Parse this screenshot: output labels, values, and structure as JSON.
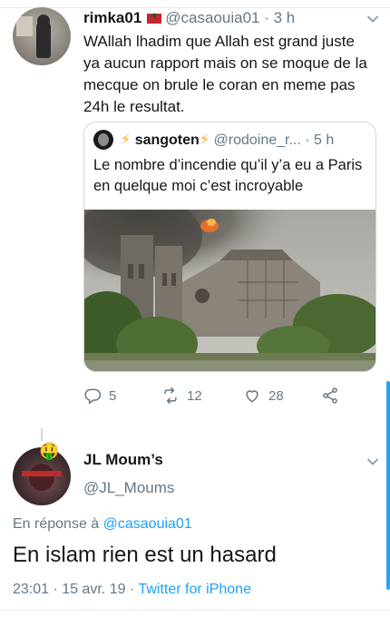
{
  "tweet": {
    "name": "rimka01",
    "handle": "@casaouia01",
    "time": "· 3 h",
    "text": "WAllah lhadim que Allah est grand juste ya aucun rapport mais on se moque de la mecque on brule le coran en meme pas 24h le resultat."
  },
  "quote": {
    "bolt": "⚡",
    "name": "sangoten",
    "handle": "@rodoine_r...",
    "time": "· 5 h",
    "text": "Le nombre d’incendie qu’il y’a eu a Paris en quelque moi c’est incroyable"
  },
  "actions": {
    "replies": "5",
    "retweets": "12",
    "likes": "28"
  },
  "reply_tweet": {
    "avatar_emoji": "🤑",
    "name": "JL Moum’s",
    "handle": "@JL_Moums",
    "reply_prefix": "En réponse à",
    "reply_to": "@casaouia01",
    "text": "En islam rien est un hasard",
    "timestamp": "23:01 · 15 avr. 19 ·",
    "source": "Twitter for iPhone"
  },
  "colors": {
    "link": "#1da1f2",
    "muted": "#657786",
    "text": "#14171a",
    "border": "#ccd6dd"
  },
  "icons": {
    "reply": "reply-icon",
    "retweet": "retweet-icon",
    "like": "heart-icon",
    "share": "share-icon",
    "caret": "chevron-down-icon"
  }
}
